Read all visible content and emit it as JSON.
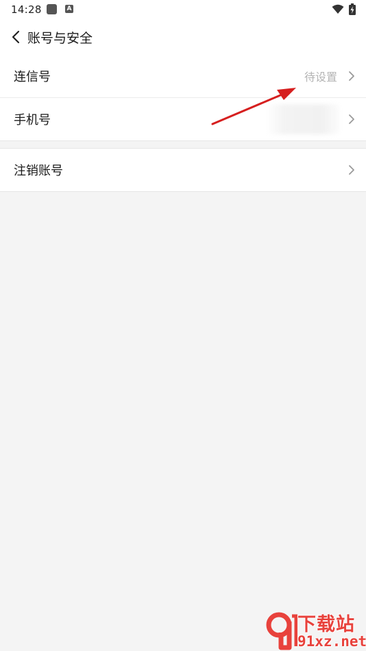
{
  "status_bar": {
    "time": "14:28",
    "badge_letter": "A",
    "icons": [
      "app-square-icon",
      "a-badge-icon",
      "wifi-icon",
      "battery-charging-icon"
    ]
  },
  "header": {
    "title": "账号与安全",
    "back_icon": "chevron-left-icon"
  },
  "rows": [
    {
      "label": "连信号",
      "value": "待设置",
      "icon": "chevron-right-icon"
    },
    {
      "label": "手机号",
      "value": "",
      "icon": "chevron-right-icon"
    },
    {
      "label": "注销账号",
      "value": "",
      "icon": "chevron-right-icon"
    }
  ],
  "annotation": {
    "color": "#d61f1f",
    "icon": "red-arrow-annotation"
  },
  "watermark": {
    "text_cn": "下载站",
    "text_en": "91xz.net",
    "color": "#e8423c"
  },
  "colors": {
    "background": "#f4f4f4",
    "row_background": "#ffffff",
    "value_text": "#b4b4b4"
  }
}
